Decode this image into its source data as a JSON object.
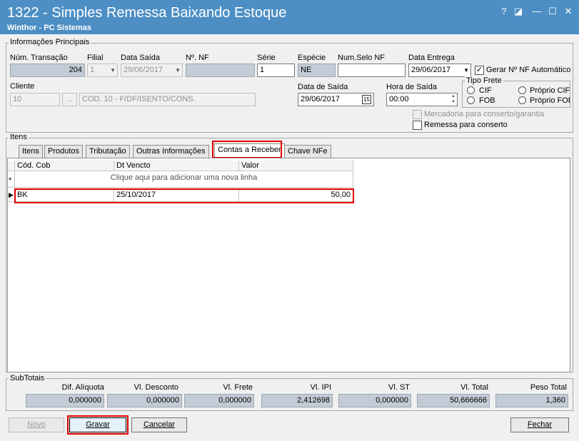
{
  "window": {
    "title": "1322 - Simples Remessa Baixando Estoque",
    "subtitle": "Winthor - PC Sistemas",
    "buttons": [
      "?",
      "◪",
      "—",
      "☐",
      "✕"
    ]
  },
  "info": {
    "legend": "Informações Principais",
    "num_transacao_label": "Núm. Transação",
    "num_transacao": "204",
    "filial_label": "Filial",
    "filial": "1",
    "data_saida_label": "Data Saída",
    "data_saida": "29/06/2017",
    "num_nf_label": "Nº. NF",
    "num_nf": "",
    "serie_label": "Série",
    "serie": "1",
    "especie_label": "Espécie",
    "especie": "NE",
    "num_selo_label": "Num.Selo NF",
    "num_selo": "",
    "data_entrega_label": "Data Entrega",
    "data_entrega": "29/06/2017",
    "gerar_nf_label": "Gerar Nº NF Automático",
    "cliente_label": "Cliente",
    "cliente_code": "10",
    "cliente_btn": "...",
    "cliente_name": "COD. 10 - F/DF/ISENTO/CONS.",
    "data_de_saida_label": "Data de Saída",
    "data_de_saida": "29/06/2017",
    "calendar_icon_text": "15",
    "hora_saida_label": "Hora de Saída",
    "hora_saida": "00:00",
    "tipo_frete_label": "Tipo Frete",
    "frete_options": [
      "CIF",
      "FOB",
      "Próprio CIF",
      "Próprio FOB"
    ],
    "mercadoria_conserto_label": "Mercadoria para conserto/garantia",
    "remessa_conserto_label": "Remessa para conserto"
  },
  "itens": {
    "legend": "Itens",
    "tabs": [
      "Itens",
      "Produtos",
      "Tributação",
      "Outras Informações",
      "Contas a Receber",
      "Chave NFe"
    ],
    "active_tab": "Contas a Receber",
    "columns": [
      "Cód. Cob",
      "Dt Vencto",
      "Valor"
    ],
    "new_row_marker": "*",
    "new_row_text": "Clique aqui para adicionar uma nova linha",
    "rows": [
      {
        "cod_cob": "BK",
        "dt_vencto": "25/10/2017",
        "valor": "50,00"
      }
    ]
  },
  "subtotais": {
    "legend": "SubTotais",
    "labels": [
      "Dif. Alíquota",
      "Vl. Desconto",
      "Vl. Frete",
      "Vl. IPI",
      "Vl. ST",
      "Vl. Total",
      "Peso Total"
    ],
    "values": [
      "0,000000",
      "0,000000",
      "0,000000",
      "2,412698",
      "0,000000",
      "50,666666",
      "1,360"
    ]
  },
  "footer": {
    "novo": "Novo",
    "gravar": "Gravar",
    "cancelar": "Cancelar",
    "fechar": "Fechar"
  }
}
